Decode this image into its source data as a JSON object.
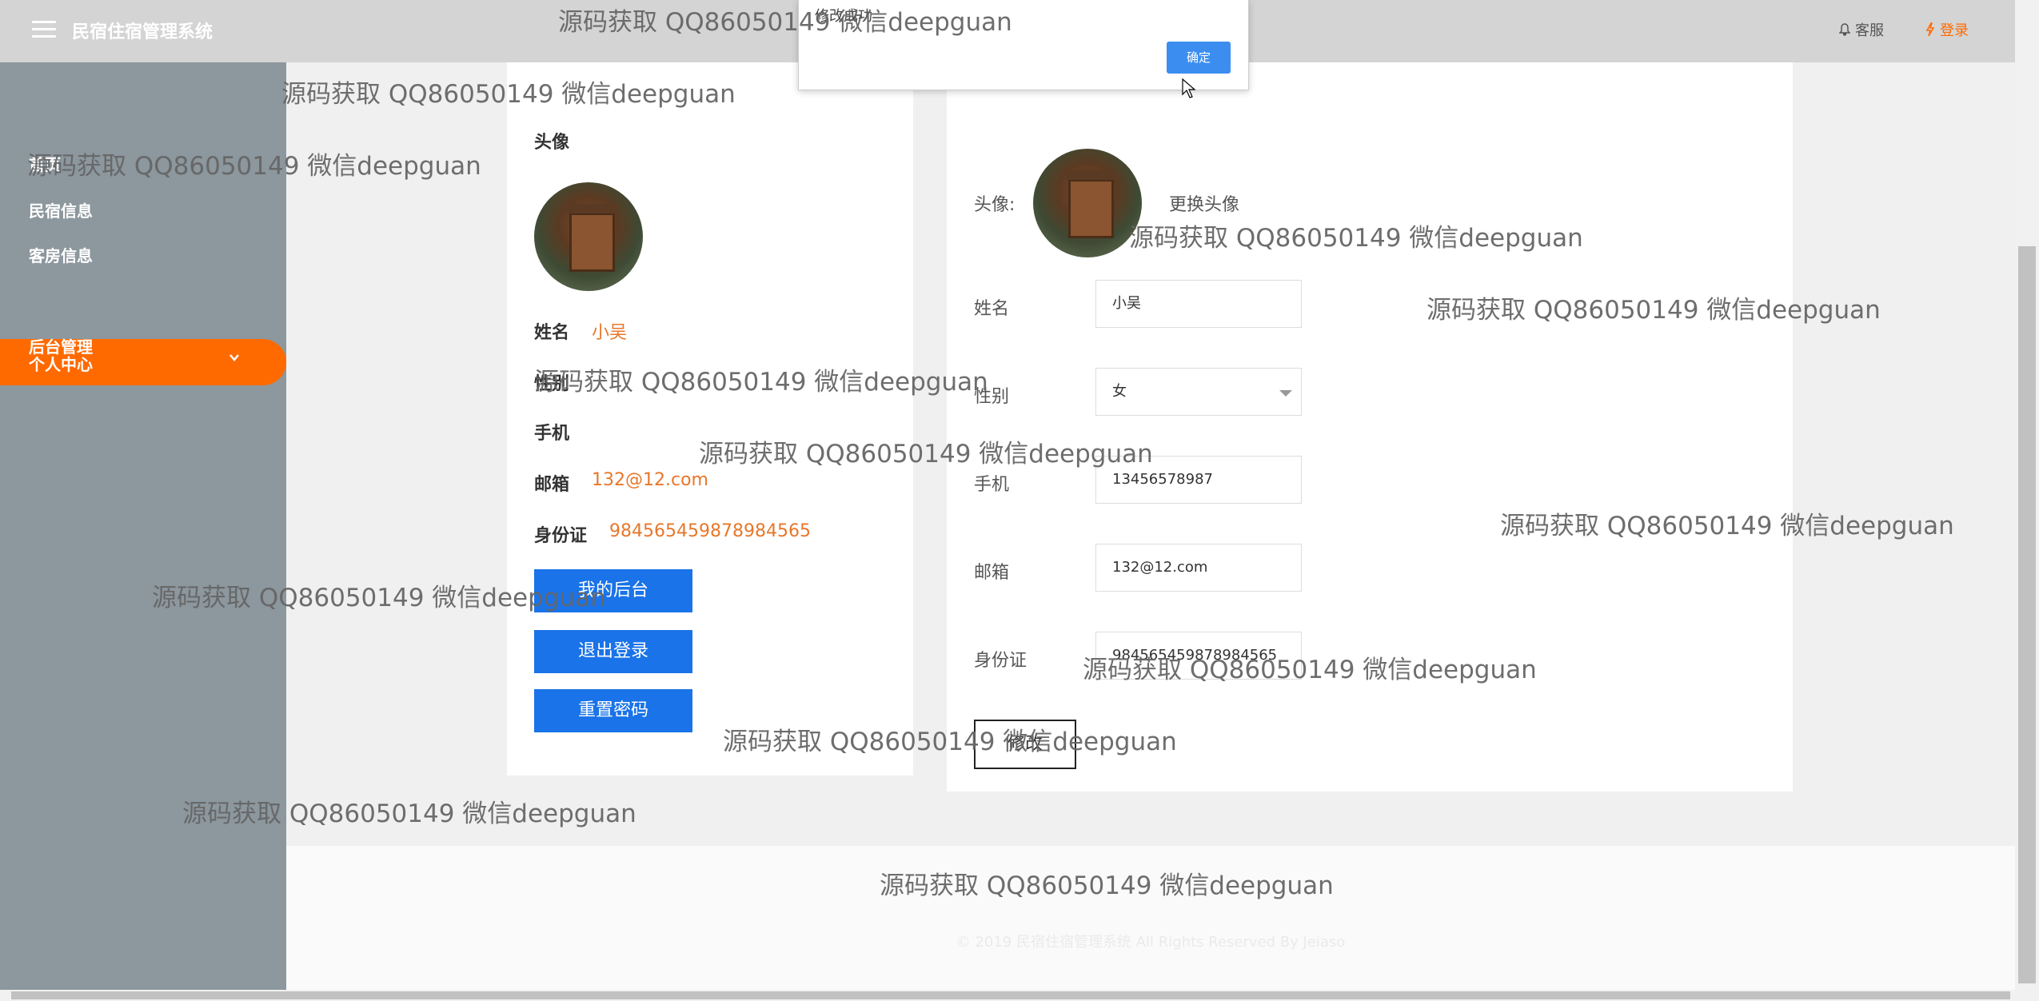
{
  "header": {
    "app_title": "民宿住宿管理系统",
    "service_label": "客服",
    "login_label": "登录"
  },
  "sidebar": {
    "items": [
      {
        "label": "首页"
      },
      {
        "label": "民宿信息"
      },
      {
        "label": "客房信息"
      },
      {
        "label": "个人中心"
      },
      {
        "label": "后台管理"
      }
    ]
  },
  "profile_card": {
    "avatar_label": "头像",
    "name_label": "姓名",
    "name_value": "小吴",
    "gender_label": "性别",
    "phone_label": "手机",
    "email_label": "邮箱",
    "email_value": "132@12.com",
    "idcard_label": "身份证",
    "idcard_value": "984565459878984565",
    "buttons": {
      "my_backend": "我的后台",
      "logout": "退出登录",
      "reset_password": "重置密码"
    }
  },
  "edit_form": {
    "avatar_label": "头像:",
    "change_avatar": "更换头像",
    "name_label": "姓名",
    "name_value": "小吴",
    "gender_label": "性别",
    "gender_value": "女",
    "phone_label": "手机",
    "phone_value": "13456578987",
    "email_label": "邮箱",
    "email_value": "132@12.com",
    "idcard_label": "身份证",
    "idcard_value": "984565459878984565",
    "submit_label": "修改"
  },
  "dialog": {
    "message": "修改成功",
    "ok_label": "确定"
  },
  "footer": {
    "copyright": "© 2019 民宿住宿管理系统 All Rights Reserved By Jeiaso"
  },
  "watermark": "源码获取 QQ86050149 微信deepguan",
  "colors": {
    "accent": "#ff6a00",
    "primary_button": "#1a73e8",
    "sidebar_bg": "#8c979e",
    "value_text": "#e8772a"
  }
}
